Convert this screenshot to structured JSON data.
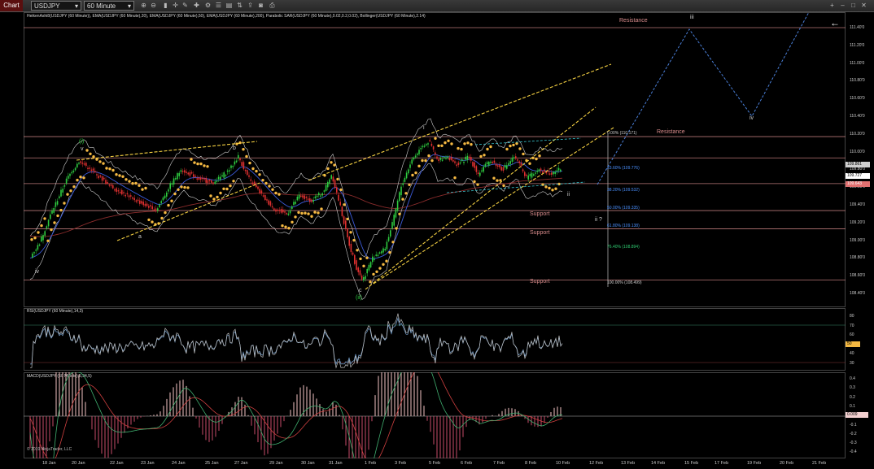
{
  "toolbar": {
    "chart_tab": "Chart",
    "instrument": "USDJPY",
    "interval": "60 Minute",
    "icons": [
      "zoom-in-icon",
      "zoom-out-icon",
      "bar-style-icon",
      "crosshair-icon",
      "drawing-tools-icon",
      "indicators-icon",
      "strategies-icon",
      "properties-icon",
      "data-box-icon",
      "chart-trader-icon",
      "share-icon",
      "snapshot-icon",
      "print-icon",
      "add-icon",
      "minimize-icon",
      "maximize-icon",
      "close-icon"
    ]
  },
  "price_panel": {
    "title": "HeikenAshi8(USDJPY (60 Minute)), EMA(USDJPY (60 Minute),20), EMA(USDJPY (60 Minute),50), EMA(USDJPY (60 Minute),200), Parabolic SAR(USDJPY (60 Minute),0.02,0.2,0.02), Bollinger(USDJPY (60 Minute),2.14)",
    "y_ticks": [
      "111.40'0",
      "111.20'0",
      "111.00'0",
      "110.80'0",
      "110.60'0",
      "110.40'0",
      "110.20'0",
      "110.00'0",
      "109.80'0",
      "109.60'0",
      "109.40'0",
      "109.20'0",
      "109.00'0",
      "108.80'0",
      "108.60'0",
      "108.40'0"
    ],
    "price_markers": [
      {
        "label": "109.861",
        "bg": "#cfcfcf",
        "fg": "#000"
      },
      {
        "label": "109.727",
        "bg": "#ffffff",
        "fg": "#000"
      },
      {
        "label": "109.643",
        "bg": "#e07070",
        "fg": "#fff"
      }
    ],
    "levels": [
      {
        "label": "Resistance",
        "price": 111.4
      },
      {
        "label": "Resistance",
        "price": 110.17
      },
      {
        "label": "Support",
        "price": 109.335
      },
      {
        "label": "Support",
        "price": 109.13
      },
      {
        "label": "Support",
        "price": 108.55
      }
    ],
    "fib": [
      {
        "label": "0.00% (110.171)",
        "color": "#cccccc"
      },
      {
        "label": "23.60% (109.776)",
        "color": "#4a90ff"
      },
      {
        "label": "38.20% (109.532)",
        "color": "#4a90ff"
      },
      {
        "label": "50.00% (109.335)",
        "color": "#4a90ff"
      },
      {
        "label": "61.80% (109.138)",
        "color": "#4a90ff"
      },
      {
        "label": "76.40% (108.894)",
        "color": "#2ecc71"
      },
      {
        "label": "100.00% (108.499)",
        "color": "#cccccc"
      }
    ],
    "waves": {
      "w1": "(i)",
      "v": "v",
      "b": "b",
      "a": "a",
      "iv": "iv",
      "c": "c",
      "w2": "(ii)",
      "i": "i",
      "ii": "ii",
      "ii_q": "ii ?",
      "iii": "iii",
      "iv2": "iv"
    },
    "copyright": "© 2019 NinjaTrader, LLC"
  },
  "rsi_panel": {
    "title": "RSI(USDJPY (60 Minute),14,3)",
    "y_ticks": [
      "80",
      "70",
      "60",
      "50",
      "40",
      "30"
    ],
    "current": "50"
  },
  "macd_panel": {
    "title": "MACD(USDJPY (60 Minute),5,34,5)",
    "y_ticks": [
      "0.4",
      "0.3",
      "0.2",
      "0.1",
      "0",
      "-0.1",
      "-0.2",
      "-0.3",
      "-0.4"
    ],
    "current": "0.009"
  },
  "x_axis": [
    "18 Jan",
    "20 Jan",
    "22 Jan",
    "23 Jan",
    "24 Jan",
    "25 Jan",
    "27 Jan",
    "29 Jan",
    "30 Jan",
    "31 Jan",
    "1 Feb",
    "3 Feb",
    "5 Feb",
    "6 Feb",
    "7 Feb",
    "8 Feb",
    "10 Feb",
    "12 Feb",
    "13 Feb",
    "14 Feb",
    "15 Feb",
    "17 Feb",
    "19 Feb",
    "20 Feb",
    "21 Feb"
  ],
  "colors": {
    "ema20": "#3b5bdb",
    "ema200": "#8b2c2c",
    "sar": "#f5b942",
    "bollinger": "#cccccc",
    "resistance": "#d98c8c",
    "channel": "#f5d142",
    "projection": "#4a7fd8",
    "bull": "#2ecc40",
    "bear": "#e03030"
  }
}
